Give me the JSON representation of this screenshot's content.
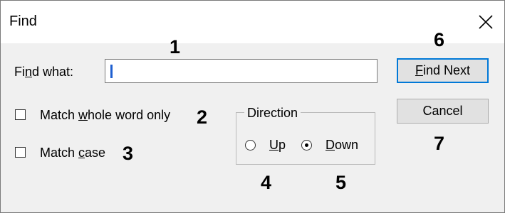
{
  "dialog": {
    "title": "Find",
    "close_icon": "close-icon"
  },
  "find": {
    "label_prefix": "Fi",
    "label_underlined": "n",
    "label_suffix": "d what:",
    "value": ""
  },
  "options": {
    "whole_word": {
      "prefix": "Match ",
      "underlined": "w",
      "suffix": "hole word only",
      "checked": false
    },
    "match_case": {
      "prefix": "Match ",
      "underlined": "c",
      "suffix": "ase",
      "checked": false
    }
  },
  "direction": {
    "legend": "Direction",
    "up": {
      "underlined": "U",
      "suffix": "p",
      "selected": false
    },
    "down": {
      "underlined": "D",
      "suffix": "own",
      "selected": true
    }
  },
  "buttons": {
    "find_next": {
      "underlined": "F",
      "suffix": "ind Next"
    },
    "cancel": {
      "label": "Cancel"
    }
  },
  "markers": [
    "1",
    "2",
    "3",
    "4",
    "5",
    "6",
    "7"
  ],
  "colors": {
    "focus_border": "#0078d7",
    "caret": "#1e5fd0",
    "dialog_bg": "#f0f0f0"
  }
}
